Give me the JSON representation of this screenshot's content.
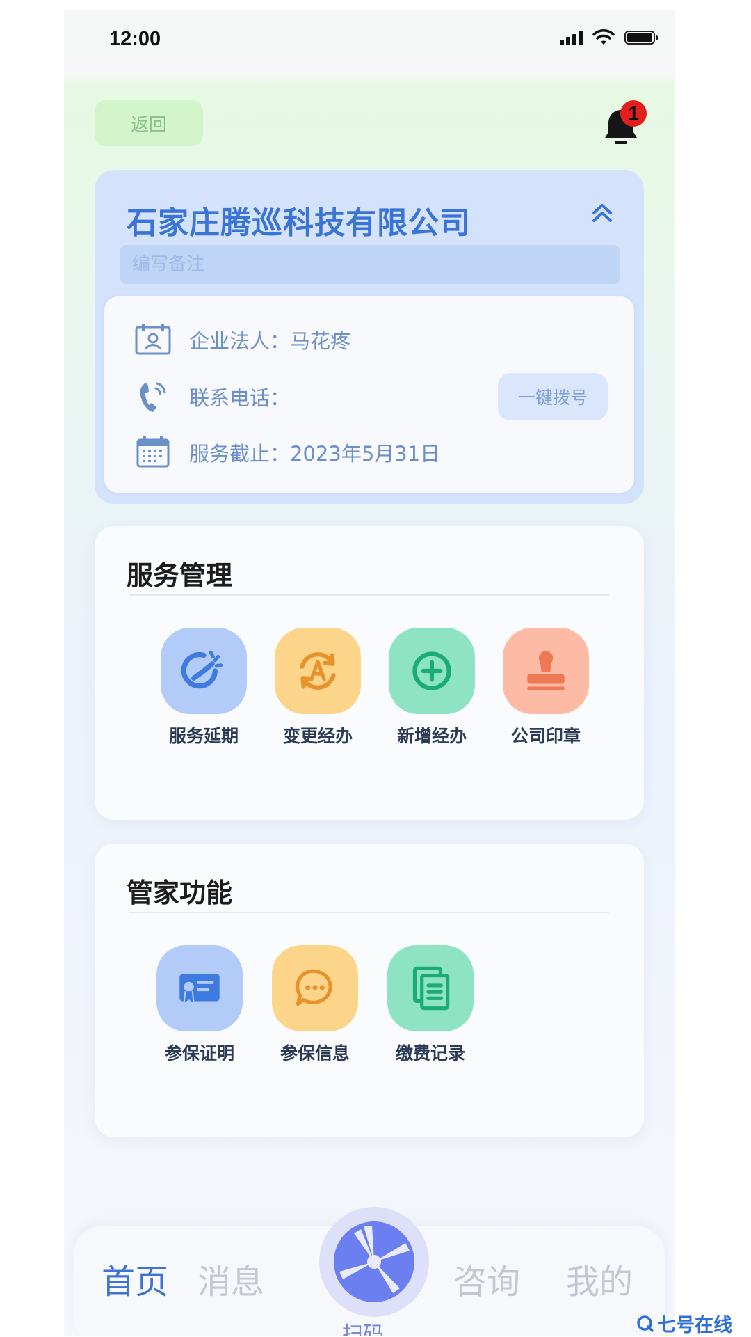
{
  "status_bar": {
    "time": "12:00"
  },
  "header": {
    "back_label": "返回",
    "notification_count": "1"
  },
  "company": {
    "name": "石家庄腾巡科技有限公司",
    "note_placeholder": "编写备注",
    "legal_label": "企业法人：",
    "legal_value": "马花疼",
    "phone_label": "联系电话：",
    "phone_value": "",
    "dial_label": "一键拨号",
    "service_label": "服务截止：",
    "service_value": "2023年5月31日"
  },
  "service_section": {
    "title": "服务管理",
    "items": [
      {
        "label": "服务延期",
        "icon": "clock-extend-icon",
        "color": "#b3cbf8",
        "fg": "#3d7be0"
      },
      {
        "label": "变更经办",
        "icon": "change-agent-icon",
        "color": "#fcd48a",
        "fg": "#e8922a"
      },
      {
        "label": "新增经办",
        "icon": "add-agent-icon",
        "color": "#8de3c2",
        "fg": "#1aab78"
      },
      {
        "label": "公司印章",
        "icon": "stamp-icon",
        "color": "#fdbba6",
        "fg": "#ee7a55"
      }
    ]
  },
  "steward_section": {
    "title": "管家功能",
    "items": [
      {
        "label": "参保证明",
        "icon": "certificate-icon",
        "color": "#b3cbf8",
        "fg": "#3d7be0"
      },
      {
        "label": "参保信息",
        "icon": "message-icon",
        "color": "#fcd48a",
        "fg": "#e8922a"
      },
      {
        "label": "缴费记录",
        "icon": "records-icon",
        "color": "#8de3c2",
        "fg": "#1aab78"
      }
    ]
  },
  "tab_bar": {
    "home": "首页",
    "messages": "消息",
    "scan": "扫码",
    "consult": "咨询",
    "mine": "我的"
  },
  "watermark": {
    "text": "七号在线"
  },
  "colors": {
    "accent": "#3f73d0",
    "badge": "#e41e1e"
  }
}
